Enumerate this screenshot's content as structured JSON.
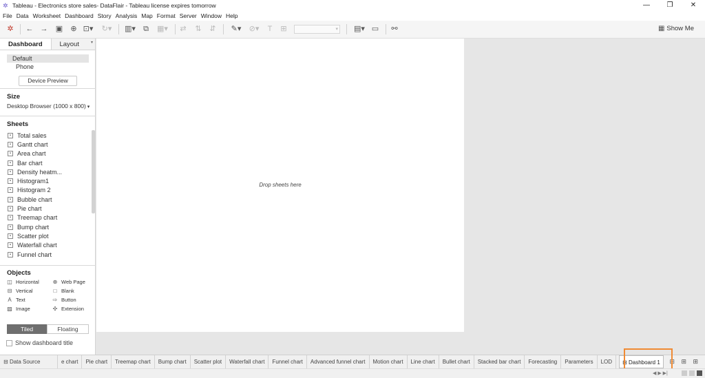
{
  "window": {
    "title": "Tableau - Electronics store sales- DataFlair - Tableau license expires tomorrow",
    "controls": [
      "—",
      "❐",
      "✕"
    ]
  },
  "menu": [
    "File",
    "Data",
    "Worksheet",
    "Dashboard",
    "Story",
    "Analysis",
    "Map",
    "Format",
    "Server",
    "Window",
    "Help"
  ],
  "toolbar": {
    "show_me": "Show Me"
  },
  "left_panel": {
    "tabs": {
      "dashboard": "Dashboard",
      "layout": "Layout"
    },
    "devices": [
      "Default",
      "Phone"
    ],
    "device_preview": "Device Preview",
    "size_header": "Size",
    "size_value": "Desktop Browser (1000 x 800)",
    "sheets_header": "Sheets",
    "sheets": [
      "Total sales",
      "Gantt chart",
      "Area chart",
      "Bar chart",
      "Density heatm...",
      "Histogram1",
      "Histogram 2",
      "Bubble chart",
      "Pie chart",
      "Treemap chart",
      "Bump chart",
      "Scatter plot",
      "Waterfall chart",
      "Funnel chart"
    ],
    "objects_header": "Objects",
    "objects": [
      "Horizontal",
      "Web Page",
      "Vertical",
      "Blank",
      "Text",
      "Button",
      "Image",
      "Extension"
    ],
    "tiled": "Tiled",
    "floating": "Floating",
    "show_title": "Show dashboard title"
  },
  "canvas": {
    "drop_text": "Drop sheets here"
  },
  "bottom_tabs": {
    "data_source": "Data Source",
    "tabs": [
      "e chart",
      "Pie chart",
      "Treemap chart",
      "Bump chart",
      "Scatter plot",
      "Waterfall chart",
      "Funnel chart",
      "Advanced funnel chart",
      "Motion chart",
      "Line chart",
      "Bullet chart",
      "Stacked bar chart",
      "Forecasting",
      "Parameters",
      "LOD"
    ],
    "active": "Dashboard 1"
  },
  "colors": {
    "highlight": "#f08a33",
    "tiled_active": "#6f6f6f"
  }
}
